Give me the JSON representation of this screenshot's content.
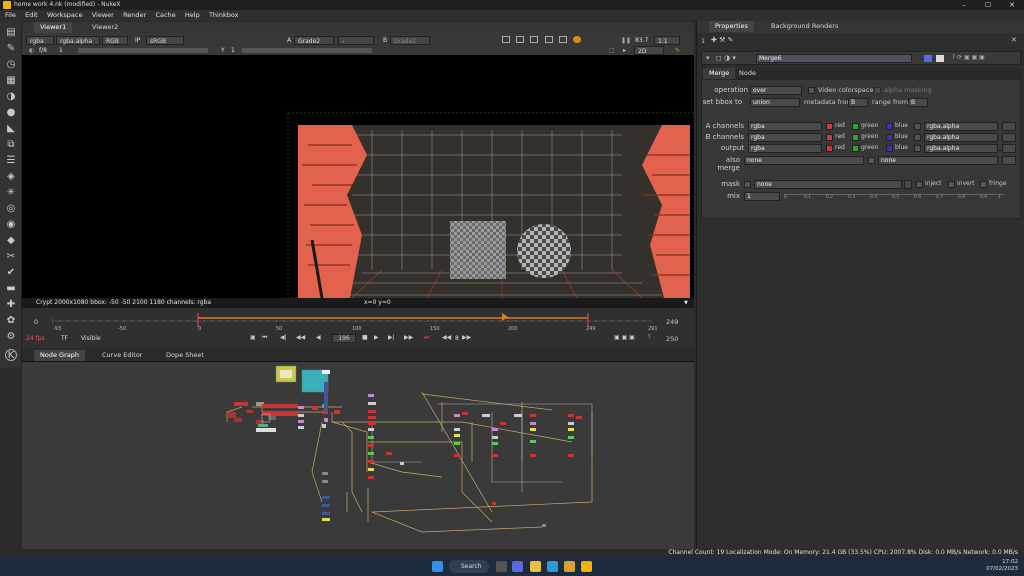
{
  "window": {
    "title": "home work 4.nk (modified) - NukeX",
    "controls": [
      "–",
      "☐",
      "✕"
    ]
  },
  "menu": [
    "File",
    "Edit",
    "Workspace",
    "Viewer",
    "Render",
    "Cache",
    "Help",
    "Thinkbox"
  ],
  "viewer_tabs": [
    "Viewer1",
    "Viewer2"
  ],
  "viewer_controls": {
    "channels": "rgba",
    "alpha": "rgba.alpha",
    "display": "RGB",
    "ip_label": "IP",
    "colorspace": "sRGB",
    "a_label": "A",
    "a_input": "Grade2",
    "wipe": "-",
    "b_label": "B",
    "b_input": "Grade2",
    "fstop": "f/8",
    "frame_step": "1",
    "y_label": "Y",
    "y_value": "1",
    "zoom": "83.7",
    "ratio": "1:1",
    "view_mode": "2D"
  },
  "viewer_status": {
    "info": "Crypt 2000x1080  bbox: -50 -50 2100 1180 channels: rgba",
    "coords": "x=0 y=0"
  },
  "timeline": {
    "start": "0",
    "end": "249",
    "out": "250",
    "current_frame": "196",
    "fps": "24 fps",
    "tf": "TF",
    "visible": "Visible",
    "step": "8",
    "ticks": [
      "-93",
      "-50",
      "0",
      "50",
      "100",
      "150",
      "200",
      "249",
      "291"
    ],
    "marker": "200"
  },
  "node_graph_tabs": [
    "Node Graph",
    "Curve Editor",
    "Dope Sheet"
  ],
  "properties": {
    "tabs": [
      "Properties",
      "Background Renders"
    ],
    "count": "1",
    "node_name": "Merge6",
    "sub_tabs": [
      "Merge",
      "Node"
    ],
    "operation_label": "operation",
    "operation": "over",
    "video_colorspace": "Video colorspace",
    "alpha_masking": "alpha masking",
    "set_bbox_label": "set bbox to",
    "set_bbox": "union",
    "metadata_from_label": "metadata from",
    "metadata_from": "B",
    "range_from_label": "range from",
    "range_from": "B",
    "a_channels_label": "A channels",
    "a_channels": "rgba",
    "b_channels_label": "B channels",
    "b_channels": "rgba",
    "output_label": "output",
    "output": "rgba",
    "also_merge_label": "also merge",
    "also_merge": "none",
    "also_merge2": "none",
    "red": "red",
    "green": "green",
    "blue": "blue",
    "alpha_ch": "rgba.alpha",
    "mask_label": "mask",
    "mask": "none",
    "inject": "inject",
    "invert": "invert",
    "fringe": "fringe",
    "mix_label": "mix",
    "mix": "1",
    "mix_ticks": [
      "0",
      "0.1",
      "0.2",
      "0.3",
      "0.4",
      "0.5",
      "0.6",
      "0.7",
      "0.8",
      "0.9",
      "1"
    ]
  },
  "status_bar": "Channel Count: 19  Localization Mode: On  Memory: 21.4 GB (33.5%)  CPU: 2007.8%  Disk: 0.0 MB/s  Network: 0.0 MB/s",
  "taskbar": {
    "search": "Search",
    "time": "17:02",
    "date": "07/02/2023"
  }
}
